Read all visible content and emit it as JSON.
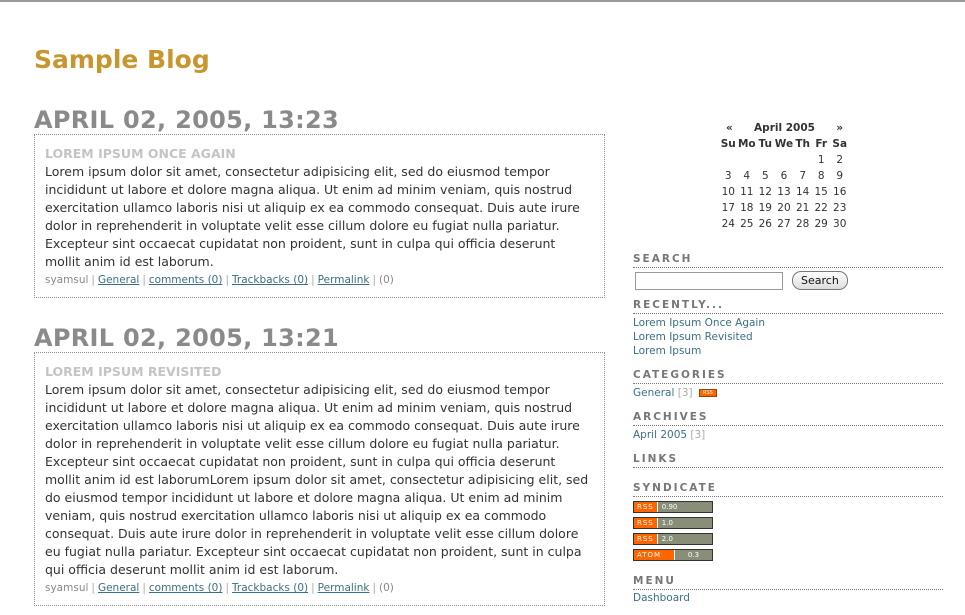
{
  "blog": {
    "title": "Sample Blog"
  },
  "posts": [
    {
      "date": "APRIL 02, 2005, 13:23",
      "title": "LOREM IPSUM ONCE AGAIN",
      "body": "Lorem ipsum dolor sit amet, consectetur adipisicing elit, sed do eiusmod tempor incididunt ut labore et dolore magna aliqua. Ut enim ad minim veniam, quis nostrud exercitation ullamco laboris nisi ut aliquip ex ea commodo consequat. Duis aute irure dolor in reprehenderit in voluptate velit esse cillum dolore eu fugiat nulla pariatur. Excepteur sint occaecat cupidatat non proident, sunt in culpa qui officia deserunt mollit anim id est laborum.",
      "author": "syamsul",
      "category": "General",
      "comments": "comments (0)",
      "trackbacks": "Trackbacks (0)",
      "permalink": "Permalink",
      "views": "(0)"
    },
    {
      "date": "APRIL 02, 2005, 13:21",
      "title": "LOREM IPSUM REVISITED",
      "body": "Lorem ipsum dolor sit amet, consectetur adipisicing elit, sed do eiusmod tempor incididunt ut labore et dolore magna aliqua. Ut enim ad minim veniam, quis nostrud exercitation ullamco laboris nisi ut aliquip ex ea commodo consequat. Duis aute irure dolor in reprehenderit in voluptate velit esse cillum dolore eu fugiat nulla pariatur. Excepteur sint occaecat cupidatat non proident, sunt in culpa qui officia deserunt mollit anim id est laborumLorem ipsum dolor sit amet, consectetur adipisicing elit, sed do eiusmod tempor incididunt ut labore et dolore magna aliqua. Ut enim ad minim veniam, quis nostrud exercitation ullamco laboris nisi ut aliquip ex ea commodo consequat. Duis aute irure dolor in reprehenderit in voluptate velit esse cillum dolore eu fugiat nulla pariatur. Excepteur sint occaecat cupidatat non proident, sunt in culpa qui officia deserunt mollit anim id est laborum.",
      "author": "syamsul",
      "category": "General",
      "comments": "comments (0)",
      "trackbacks": "Trackbacks (0)",
      "permalink": "Permalink",
      "views": "(0)"
    }
  ],
  "calendar": {
    "prev": "«",
    "month": "April 2005",
    "next": "»",
    "days": [
      "Su",
      "Mo",
      "Tu",
      "We",
      "Th",
      "Fr",
      "Sa"
    ],
    "weeks": [
      [
        "",
        "",
        "",
        "",
        "",
        "1",
        "2"
      ],
      [
        "3",
        "4",
        "5",
        "6",
        "7",
        "8",
        "9"
      ],
      [
        "10",
        "11",
        "12",
        "13",
        "14",
        "15",
        "16"
      ],
      [
        "17",
        "18",
        "19",
        "20",
        "21",
        "22",
        "23"
      ],
      [
        "24",
        "25",
        "26",
        "27",
        "28",
        "29",
        "30"
      ]
    ]
  },
  "sidebar": {
    "search": {
      "heading": "SEARCH",
      "value": "",
      "button": "Search"
    },
    "recently": {
      "heading": "RECENTLY...",
      "items": [
        "Lorem Ipsum Once Again",
        "Lorem Ipsum Revisited",
        "Lorem Ipsum"
      ]
    },
    "categories": {
      "heading": "CATEGORIES",
      "items": [
        {
          "label": "General",
          "count": "[3]",
          "feed": "RSS"
        }
      ]
    },
    "archives": {
      "heading": "ARCHIVES",
      "items": [
        {
          "label": "April 2005",
          "count": "[3]"
        }
      ]
    },
    "links": {
      "heading": "LINKS"
    },
    "syndicate": {
      "heading": "SYNDICATE",
      "feeds": [
        {
          "left": "RSS",
          "right": "0.90"
        },
        {
          "left": "RSS",
          "right": "1.0"
        },
        {
          "left": "RSS",
          "right": "2.0"
        },
        {
          "left": "ATOM",
          "right": "0.3"
        }
      ]
    },
    "menu": {
      "heading": "MENU",
      "items": [
        "Dashboard"
      ]
    }
  },
  "colors": {
    "title": "#c8962e",
    "date": "#8a8a8a",
    "link": "#3a6f86",
    "feed_orange": "#ff6600",
    "badge_gray": "#898e79"
  }
}
